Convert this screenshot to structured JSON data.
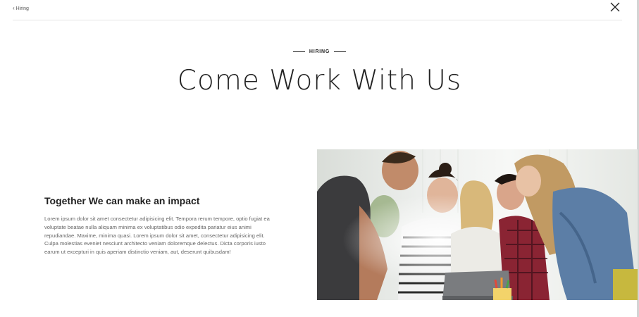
{
  "nav": {
    "back_label": "Hiring",
    "back_icon": "chevron-left-icon",
    "close_icon": "close-icon"
  },
  "hero": {
    "eyebrow": "HIRING",
    "title": "Come Work With Us"
  },
  "section": {
    "heading": "Together We can make an impact",
    "body": "Lorem ipsum dolor sit amet consectetur adipisicing elit. Tempora rerum tempore, optio fugiat ea voluptate beatae nulla aliquam minima ex voluptatibus odio expedita pariatur eius animi repudiandae. Maxime, minima quasi. Lorem ipsum dolor sit amet, consectetur adipisicing elit. Culpa molestias eveniet nesciunt architecto veniam doloremque delectus. Dicta corporis iusto earum ut excepturi in quis aperiam distinctio veniam, aut, deserunt quibusdam!"
  },
  "colors": {
    "text_dark": "#222222",
    "text_body": "#666666",
    "divider": "#e6e6e6",
    "background": "#ffffff"
  }
}
